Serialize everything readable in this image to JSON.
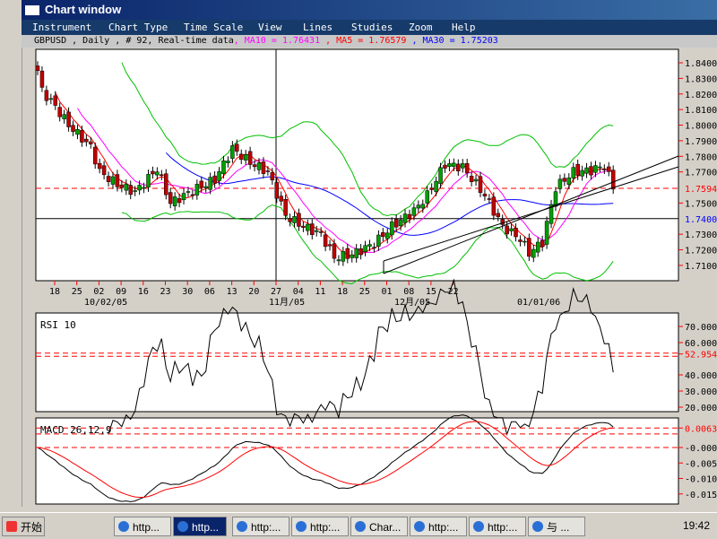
{
  "window": {
    "title": "Chart window"
  },
  "menu": [
    "Instrument",
    "Chart Type",
    "Time Scale",
    "View",
    "Lines",
    "Studies",
    "Zoom",
    "Help"
  ],
  "info": {
    "symbol": "GBPUSD , Daily , # 92, Real-time data",
    "ma10": ", MA10 = 1.76431",
    "ma5": " , MA5 = 1.76579",
    "ma30": " , MA30 = 1.75203"
  },
  "colors": {
    "ma10": "#ff00ff",
    "ma5": "#ff0000",
    "ma30": "#0000ff",
    "bollinger": "#00c000",
    "candle_up": "#00a000",
    "candle_down": "#c00000"
  },
  "chart_data": {
    "type": "candlestick",
    "price_axis": {
      "ticks": [
        "1.8400",
        "1.8300",
        "1.8200",
        "1.8100",
        "1.8000",
        "1.7900",
        "1.7800",
        "1.7700",
        "1.7500",
        "1.7300",
        "1.7200",
        "1.7100"
      ],
      "ylim": [
        1.7,
        1.85
      ],
      "highlight_red": "1.75945",
      "highlight_blue": "1.7400"
    },
    "date_ticks": [
      "18",
      "25",
      "02",
      "09",
      "16",
      "23",
      "30",
      "06",
      "13",
      "20",
      "27",
      "04",
      "11",
      "18",
      "25",
      "01",
      "08",
      "15",
      "22"
    ],
    "month_labels": [
      "10/02/05",
      "11月/05",
      "12月/05",
      "01/01/06"
    ],
    "price_waypoints": [
      [
        0,
        1.835
      ],
      [
        1,
        1.822
      ],
      [
        4,
        1.812
      ],
      [
        7,
        1.8
      ],
      [
        12,
        1.786
      ],
      [
        14,
        1.77
      ],
      [
        18,
        1.762
      ],
      [
        22,
        1.757
      ],
      [
        27,
        1.772
      ],
      [
        30,
        1.75
      ],
      [
        35,
        1.758
      ],
      [
        40,
        1.765
      ],
      [
        44,
        1.785
      ],
      [
        48,
        1.776
      ],
      [
        52,
        1.77
      ],
      [
        56,
        1.742
      ],
      [
        60,
        1.735
      ],
      [
        64,
        1.73
      ],
      [
        67,
        1.715
      ],
      [
        71,
        1.717
      ],
      [
        76,
        1.724
      ],
      [
        80,
        1.735
      ],
      [
        85,
        1.745
      ],
      [
        88,
        1.755
      ],
      [
        92,
        1.775
      ],
      [
        96,
        1.773
      ],
      [
        101,
        1.755
      ],
      [
        105,
        1.735
      ],
      [
        109,
        1.727
      ],
      [
        111,
        1.718
      ],
      [
        114,
        1.725
      ],
      [
        117,
        1.76
      ],
      [
        121,
        1.77
      ],
      [
        125,
        1.771
      ],
      [
        128,
        1.774
      ],
      [
        130,
        1.7605
      ]
    ],
    "horizontal_lines": [
      1.74,
      1.75945
    ],
    "rsi": {
      "label": "RSI 10",
      "ticks": [
        "70.0000",
        "60.0000",
        "52.9543",
        "40.0000",
        "30.0000",
        "20.0000"
      ]
    },
    "macd": {
      "label": "MACD 26,12,9",
      "ticks": [
        "0.0063",
        "-0.0000",
        "-0.0050",
        "-0.0100",
        "-0.0150"
      ]
    }
  },
  "taskbar": {
    "start": "开始",
    "items": [
      "http...",
      "http...",
      "http:...",
      "http:...",
      "Char...",
      "http:...",
      "http:...",
      "与 ..."
    ],
    "clock": "19:42"
  }
}
